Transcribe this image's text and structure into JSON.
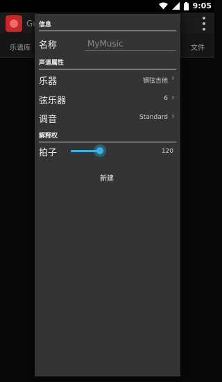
{
  "status_bar": {
    "time": "9:05"
  },
  "background_app": {
    "title": "Gu",
    "tab_left": "乐谱库",
    "tab_right": "文件"
  },
  "dialog": {
    "info_header": "信息",
    "name_label": "名称",
    "name_placeholder": "MyMusic",
    "track_header": "声道属性",
    "instrument_label": "乐器",
    "instrument_value": "钢弦吉他",
    "strings_label": "弦乐器",
    "strings_value": "6",
    "tuning_label": "调音",
    "tuning_value": "Standard",
    "interpretation_header": "解释权",
    "tempo_label": "拍子",
    "tempo_value": "120",
    "create_button": "新建"
  },
  "colors": {
    "accent": "#33b5e5",
    "dialog_bg": "#343434"
  }
}
